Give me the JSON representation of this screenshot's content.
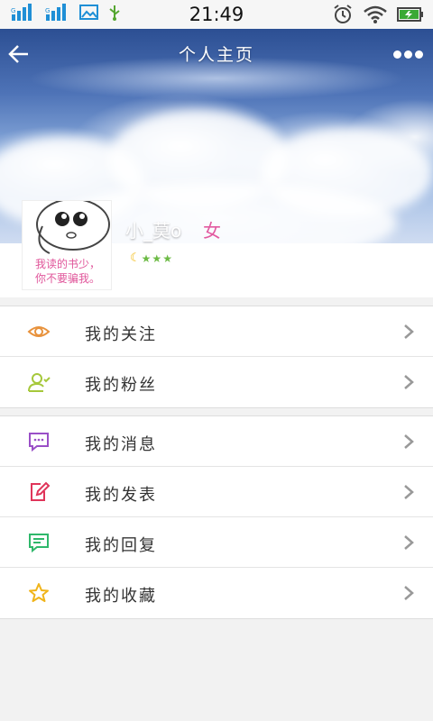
{
  "status_bar": {
    "time": "21:49",
    "icons_left": [
      "signal-icon",
      "signal-icon",
      "image-icon",
      "usb-icon"
    ],
    "icons_right": [
      "alarm-icon",
      "wifi-icon",
      "battery-icon"
    ]
  },
  "header": {
    "title": "个人主页",
    "back_icon": "back-arrow-icon",
    "more_icon": "more-icon"
  },
  "profile": {
    "username": "小_莫o",
    "gender": "女",
    "avatar_text": [
      "我读的书少，",
      "你不要骗我。"
    ],
    "level": {
      "moons": 1,
      "stars": 3
    }
  },
  "menu": {
    "group1": [
      {
        "label": "我的关注",
        "icon": "eye-icon",
        "color": "#e8923c"
      },
      {
        "label": "我的粉丝",
        "icon": "fans-icon",
        "color": "#a6c83b"
      }
    ],
    "group2": [
      {
        "label": "我的消息",
        "icon": "message-icon",
        "color": "#9a4fc7"
      },
      {
        "label": "我的发表",
        "icon": "edit-icon",
        "color": "#e0355a"
      },
      {
        "label": "我的回复",
        "icon": "reply-icon",
        "color": "#2fb86b"
      },
      {
        "label": "我的收藏",
        "icon": "star-icon",
        "color": "#f0b41a"
      }
    ]
  }
}
